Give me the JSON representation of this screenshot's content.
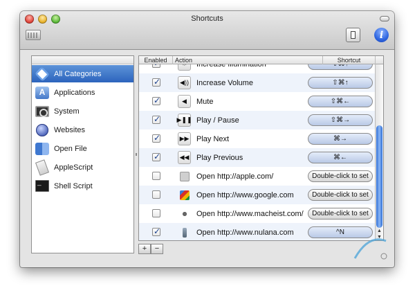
{
  "window": {
    "title": "Shortcuts"
  },
  "sidebar": {
    "items": [
      {
        "label": "All Categories",
        "icon": "all-categories-icon",
        "selected": true
      },
      {
        "label": "Applications",
        "icon": "applications-icon",
        "selected": false
      },
      {
        "label": "System",
        "icon": "system-icon",
        "selected": false
      },
      {
        "label": "Websites",
        "icon": "websites-icon",
        "selected": false
      },
      {
        "label": "Open File",
        "icon": "open-file-icon",
        "selected": false
      },
      {
        "label": "AppleScript",
        "icon": "applescript-icon",
        "selected": false
      },
      {
        "label": "Shell Script",
        "icon": "shell-script-icon",
        "selected": false
      }
    ]
  },
  "table": {
    "columns": {
      "enabled": "Enabled",
      "action": "Action",
      "shortcut": "Shortcut"
    },
    "rows": [
      {
        "enabled": true,
        "action": "Increase Illumination",
        "shortcut": "⇧⌘↑",
        "icon": "illumination-icon"
      },
      {
        "enabled": true,
        "action": "Increase Volume",
        "shortcut": "⇧⌘↑",
        "icon": "volume-up-icon"
      },
      {
        "enabled": true,
        "action": "Mute",
        "shortcut": "⇧⌘←",
        "icon": "mute-icon"
      },
      {
        "enabled": true,
        "action": "Play / Pause",
        "shortcut": "⇧⌘→",
        "icon": "play-pause-icon"
      },
      {
        "enabled": true,
        "action": "Play Next",
        "shortcut": "⌘→",
        "icon": "play-next-icon"
      },
      {
        "enabled": true,
        "action": "Play Previous",
        "shortcut": "⌘←",
        "icon": "play-previous-icon"
      },
      {
        "enabled": false,
        "action": "Open http://apple.com/",
        "shortcut": "Double-click to set",
        "icon": "apple-site-icon"
      },
      {
        "enabled": false,
        "action": "Open http://www.google.com",
        "shortcut": "Double-click to set",
        "icon": "google-site-icon"
      },
      {
        "enabled": false,
        "action": "Open http://www.macheist.com/",
        "shortcut": "Double-click to set",
        "icon": "macheist-site-icon"
      },
      {
        "enabled": true,
        "action": "Open http://www.nulana.com",
        "shortcut": "^N",
        "icon": "nulana-site-icon"
      }
    ]
  },
  "footer": {
    "add_label": "+",
    "remove_label": "−"
  }
}
